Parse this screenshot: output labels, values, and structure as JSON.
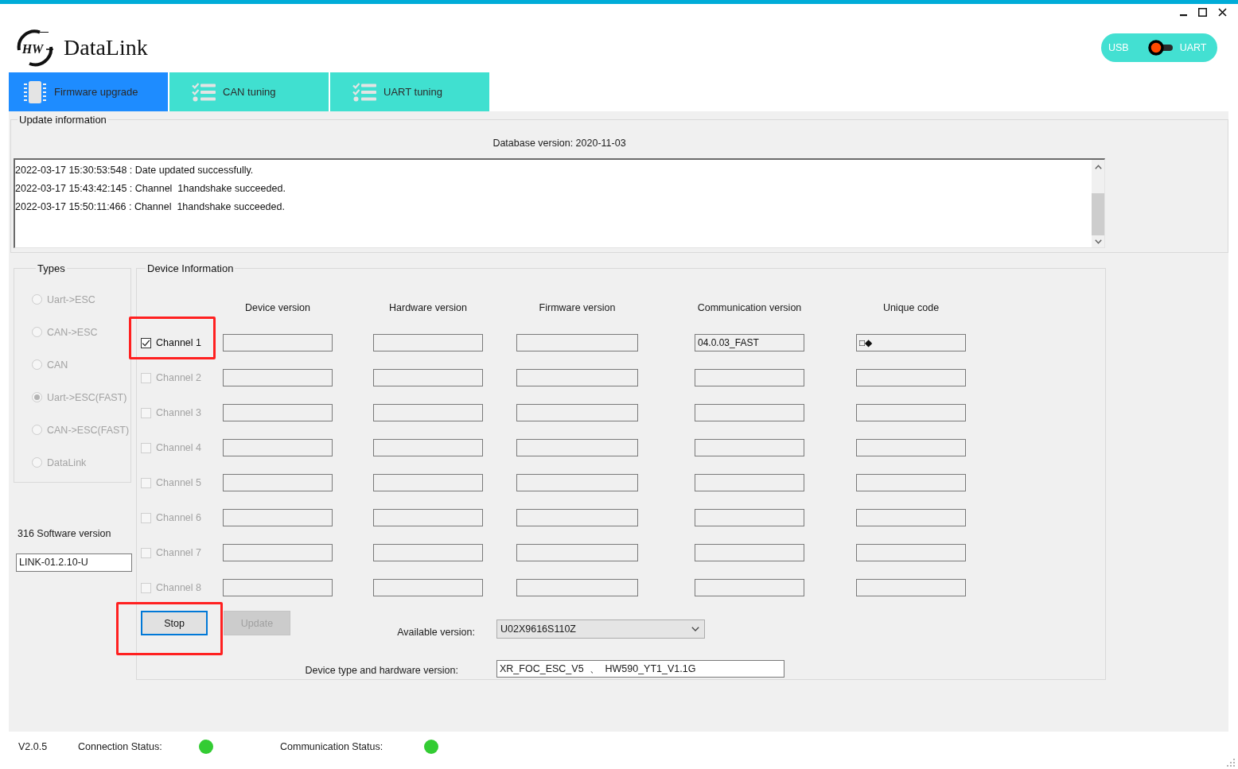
{
  "window": {
    "title": "DataLink",
    "logo_mark": "HW"
  },
  "mode_switch": {
    "left_label": "USB",
    "right_label": "UART",
    "on": false
  },
  "tabs": [
    {
      "label": "Firmware upgrade",
      "selected": true
    },
    {
      "label": "CAN tuning",
      "selected": false
    },
    {
      "label": "UART tuning",
      "selected": false
    }
  ],
  "update_information": {
    "title": "Update information",
    "database_version": "Database version: 2020-11-03",
    "log": [
      "2022-03-17 15:30:53:548 : Date updated successfully.",
      "2022-03-17 15:43:42:145 : Channel  1handshake succeeded.",
      "2022-03-17 15:50:11:466 : Channel  1handshake succeeded."
    ]
  },
  "types": {
    "title": "Types",
    "items": [
      {
        "label": "Uart->ESC",
        "selected": false,
        "disabled": true
      },
      {
        "label": "CAN->ESC",
        "selected": false,
        "disabled": true
      },
      {
        "label": "CAN",
        "selected": false,
        "disabled": true
      },
      {
        "label": "Uart->ESC(FAST)",
        "selected": true,
        "disabled": true
      },
      {
        "label": "CAN->ESC(FAST)",
        "selected": false,
        "disabled": true
      },
      {
        "label": "DataLink",
        "selected": false,
        "disabled": true
      }
    ]
  },
  "software_version": {
    "label": "316 Software version",
    "value": "LINK-01.2.10-U"
  },
  "device_information": {
    "title": "Device Information",
    "columns": [
      "Device version",
      "Hardware version",
      "Firmware version",
      "Communication version",
      "Unique code"
    ],
    "channels": [
      {
        "label": "Channel 1",
        "checked": true,
        "disabled": false,
        "highlighted": true,
        "communication_version": "04.0.03_FAST",
        "unique_code": "□◆"
      },
      {
        "label": "Channel 2",
        "checked": false,
        "disabled": true,
        "highlighted": false
      },
      {
        "label": "Channel 3",
        "checked": false,
        "disabled": true,
        "highlighted": false
      },
      {
        "label": "Channel 4",
        "checked": false,
        "disabled": true,
        "highlighted": false
      },
      {
        "label": "Channel 5",
        "checked": false,
        "disabled": true,
        "highlighted": false
      },
      {
        "label": "Channel 6",
        "checked": false,
        "disabled": true,
        "highlighted": false
      },
      {
        "label": "Channel 7",
        "checked": false,
        "disabled": true,
        "highlighted": false
      },
      {
        "label": "Channel 8",
        "checked": false,
        "disabled": true,
        "highlighted": false
      }
    ]
  },
  "buttons": [
    {
      "label": "Stop",
      "disabled": false,
      "focused": true,
      "highlighted": true
    },
    {
      "label": "Update",
      "disabled": true,
      "focused": false,
      "highlighted": false
    }
  ],
  "available_version": {
    "label": "Available version:",
    "value": "U02X9616S110Z"
  },
  "device_type": {
    "label": "Device type and hardware version:",
    "value": "XR_FOC_ESC_V5  、  HW590_YT1_V1.1G"
  },
  "status_bar": {
    "version": "V2.0.5",
    "items": [
      {
        "label": "Connection Status:",
        "color": "#33cc33"
      },
      {
        "label": "Communication Status:",
        "color": "#33cc33"
      }
    ]
  }
}
